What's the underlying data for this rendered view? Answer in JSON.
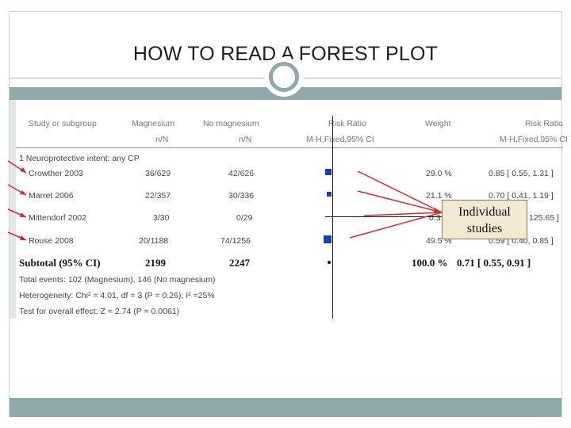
{
  "slide": {
    "title": "HOW TO READ A FOREST PLOT"
  },
  "table": {
    "headers": {
      "study": "Study or subgroup",
      "magnesium": "Magnesium",
      "no_magnesium": "No magnesium",
      "risk_ratio_left": "Risk Ratio",
      "weight": "Weight",
      "risk_ratio_right": "Risk Ratio",
      "magnesium_sub": "n/N",
      "no_magnesium_sub": "n/N",
      "method_left": "M-H,Fixed,95% CI",
      "method_right": "M-H,Fixed,95% CI"
    },
    "subgroup_label": "1 Neuroprotective intent: any CP",
    "rows": [
      {
        "study": "Crowther 2003",
        "magnesium": "36/629",
        "no_magnesium": "42/626",
        "weight": "29.0 %",
        "ci": "0.85 [ 0.55, 1.31 ]"
      },
      {
        "study": "Marret 2006",
        "magnesium": "22/357",
        "no_magnesium": "30/336",
        "weight": "21.1 %",
        "ci": "0.70 [ 0.41, 1.19 ]"
      },
      {
        "study": "Mittendorf 2002",
        "magnesium": "3/30",
        "no_magnesium": "0/29",
        "weight": "0.3",
        "ci": "125.65 ]"
      },
      {
        "study": "Rouse 2008",
        "magnesium": "20/1188",
        "no_magnesium": "74/1256",
        "weight": "49.5 %",
        "ci": "0.59 [ 0.40, 0.85 ]"
      }
    ],
    "subtotal": {
      "label": "Subtotal (95% CI)",
      "magnesium": "2199",
      "no_magnesium": "2247",
      "weight": "100.0 %",
      "ci": "0.71 [ 0.55, 0.91 ]"
    },
    "footer": [
      "Total events: 102 (Magnesium), 146 (No magnesium)",
      "Heterogeneity: Chi² = 4.01, df = 3 (P = 0.26); I² =25%",
      "Test for overall effect: Z = 2.74 (P = 0.0061)"
    ]
  },
  "callout": {
    "line1": "Individual",
    "line2": "studies"
  },
  "colors": {
    "accent_band": "#8fa9aa",
    "marker_blue": "#1a3fb0",
    "arrow_red": "#d42a2a",
    "callout_bg": "#f3e8d4"
  }
}
